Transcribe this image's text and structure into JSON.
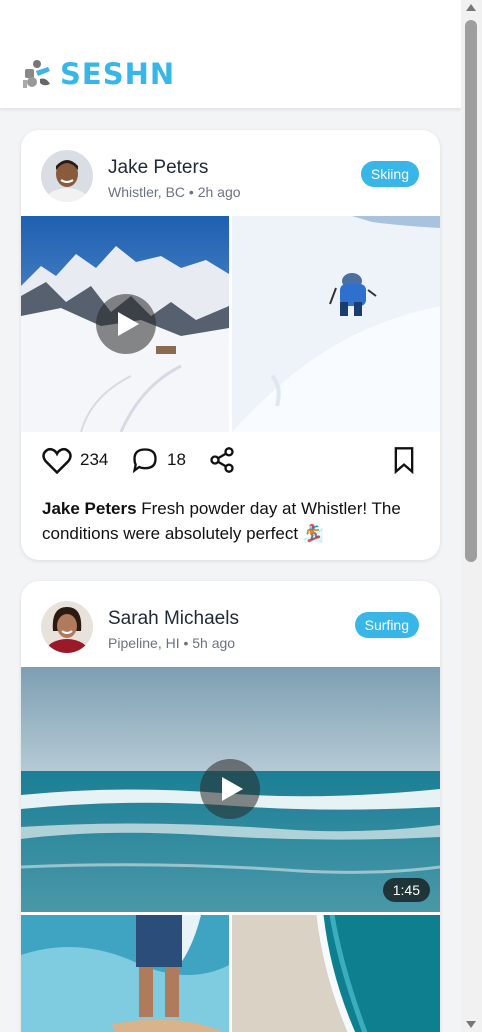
{
  "app": {
    "name": "SESHN"
  },
  "colors": {
    "accent": "#38b6e8",
    "muted": "#6b7280"
  },
  "posts": [
    {
      "user": "Jake Peters",
      "location_time": "Whistler, BC • 2h ago",
      "sport": "Skiing",
      "media": [
        {
          "kind": "video",
          "scene": "snowy alpine ski slope"
        },
        {
          "kind": "image",
          "scene": "skier in deep powder"
        }
      ],
      "likes": "234",
      "comments": "18",
      "caption_user": "Jake Peters",
      "caption_text": "Fresh powder day at Whistler! The conditions were absolutely perfect 🏂"
    },
    {
      "user": "Sarah Michaels",
      "location_time": "Pipeline, HI • 5h ago",
      "sport": "Surfing",
      "media": [
        {
          "kind": "video",
          "scene": "ocean waves",
          "duration": "1:45"
        },
        {
          "kind": "image",
          "scene": "surfer on board"
        },
        {
          "kind": "image",
          "scene": "aerial beach shoreline"
        }
      ]
    }
  ],
  "icons": [
    "logo-icon",
    "heart-icon",
    "comment-icon",
    "share-icon",
    "bookmark-icon",
    "play-icon"
  ]
}
